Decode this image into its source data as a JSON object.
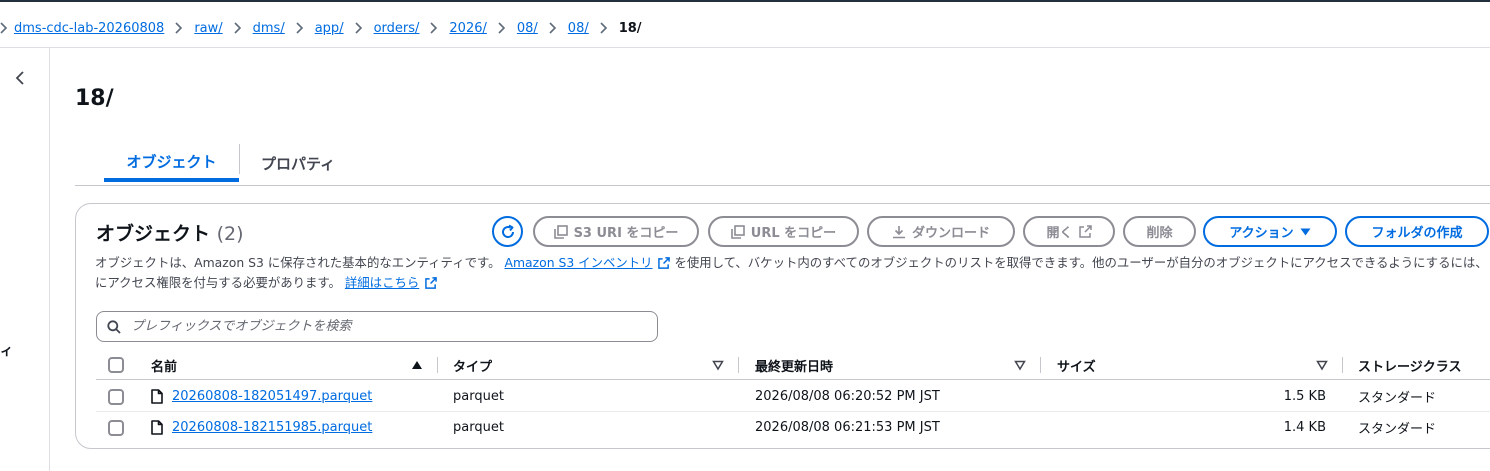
{
  "breadcrumb": {
    "items": [
      "dms-cdc-lab-20260808",
      "raw/",
      "dms/",
      "app/",
      "orders/",
      "2026/",
      "08/",
      "08/"
    ],
    "current": "18/"
  },
  "sidebar": {
    "fragment": "ィ"
  },
  "page": {
    "title": "18/"
  },
  "tabs": {
    "objects": "オブジェクト",
    "properties": "プロパティ"
  },
  "objects": {
    "heading": "オブジェクト",
    "count": "(2)",
    "buttons": {
      "copy_s3_uri": "S3 URI をコピー",
      "copy_url": "URL をコピー",
      "download": "ダウンロード",
      "open": "開く",
      "delete": "削除",
      "actions": "アクション",
      "create_folder": "フォルダの作成"
    },
    "desc": {
      "line1_pre": "オブジェクトは、Amazon S3 に保存された基本的なエンティティです。",
      "inventory_link": "Amazon S3 インベントリ",
      "line1_post": "を使用して、バケット内のすべてのオブジェクトのリストを取得できます。他のユーザーが自分のオブジェクトにアクセスできるようにするには、",
      "line2_pre": "にアクセス権限を付与する必要があります。",
      "learn_more": "詳細はこちら"
    },
    "search": {
      "placeholder": "プレフィックスでオブジェクトを検索"
    },
    "columns": {
      "name": "名前",
      "type": "タイプ",
      "last_modified": "最終更新日時",
      "size": "サイズ",
      "storage_class": "ストレージクラス"
    },
    "rows": [
      {
        "name": "20260808-182051497.parquet",
        "type": "parquet",
        "last_modified": "2026/08/08 06:20:52 PM JST",
        "size": "1.5 KB",
        "storage_class": "スタンダード"
      },
      {
        "name": "20260808-182151985.parquet",
        "type": "parquet",
        "last_modified": "2026/08/08 06:21:53 PM JST",
        "size": "1.4 KB",
        "storage_class": "スタンダード"
      }
    ]
  },
  "colors": {
    "link": "#006ce0",
    "text": "#0f141a",
    "disabled": "#8c8c94",
    "border": "#c6c6cd"
  }
}
